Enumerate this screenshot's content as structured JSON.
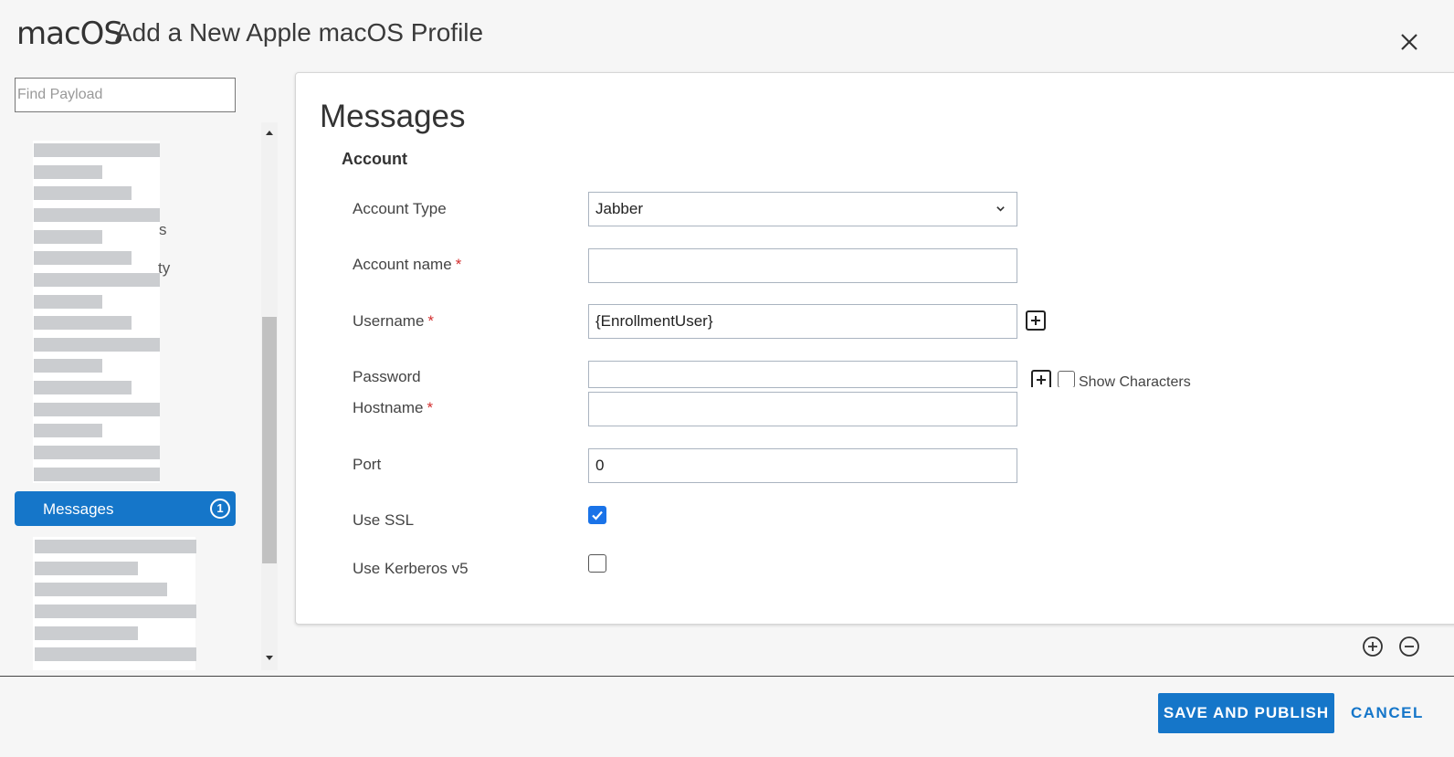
{
  "header": {
    "os_logo": "macOS",
    "title": "Add a New Apple macOS Profile"
  },
  "sidebar": {
    "search_placeholder": "Find Payload",
    "partial_labels": [
      "s",
      "ty"
    ],
    "active_item": {
      "label": "Messages",
      "count": "1"
    }
  },
  "panel": {
    "title": "Messages",
    "section": "Account",
    "fields": {
      "account_type": {
        "label": "Account Type",
        "value": "Jabber"
      },
      "account_name": {
        "label": "Account name",
        "value": "",
        "required": "*"
      },
      "username": {
        "label": "Username",
        "value": "{EnrollmentUser}",
        "required": "*"
      },
      "password": {
        "label": "Password",
        "value": "",
        "show_characters": "Show Characters"
      },
      "hostname": {
        "label": "Hostname",
        "value": "",
        "required": "*"
      },
      "port": {
        "label": "Port",
        "value": "0"
      },
      "use_ssl": {
        "label": "Use SSL",
        "checked": true
      },
      "use_kerberos": {
        "label": "Use Kerberos v5",
        "checked": false
      }
    }
  },
  "footer": {
    "save_label": "SAVE AND PUBLISH",
    "cancel_label": "CANCEL"
  },
  "colors": {
    "primary": "#1576c9",
    "checkbox_checked": "#1a73e8",
    "required": "#d32f2f"
  }
}
